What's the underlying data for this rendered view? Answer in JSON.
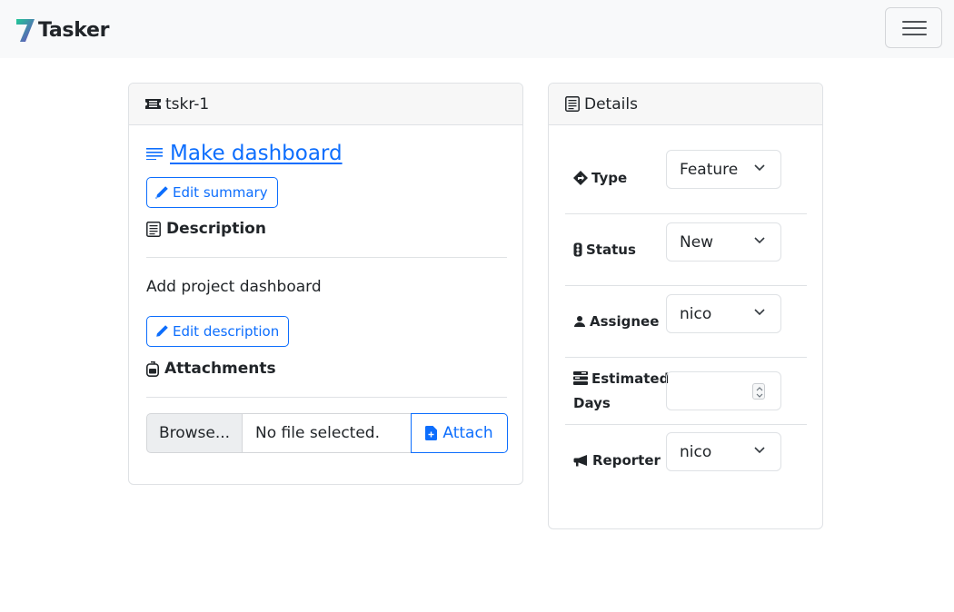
{
  "app": {
    "name": "Tasker"
  },
  "colors": {
    "primary": "#0d6efd",
    "brand_gradient": [
      "#20c997",
      "#6f42c1"
    ]
  },
  "ticket": {
    "id": "tskr-1",
    "summary": "Make dashboard",
    "edit_summary_label": "Edit summary",
    "description_heading": "Description",
    "description_text": "Add project dashboard",
    "edit_description_label": "Edit description",
    "attachments_heading": "Attachments",
    "browse_label": "Browse...",
    "file_placeholder": "No file selected.",
    "attach_label": "Attach"
  },
  "details": {
    "header": "Details",
    "fields": {
      "type": {
        "label": "Type",
        "value": "Feature",
        "icon": "diamond-arrow-icon"
      },
      "status": {
        "label": "Status",
        "value": "New",
        "icon": "traffic-light-icon"
      },
      "assignee": {
        "label": "Assignee",
        "value": "nico",
        "icon": "person-icon"
      },
      "estimated_days": {
        "label_line1": "Estimated",
        "label_line2": "Days",
        "value": "",
        "icon": "stack-icon"
      },
      "reporter": {
        "label": "Reporter",
        "value": "nico",
        "icon": "megaphone-icon"
      }
    }
  }
}
